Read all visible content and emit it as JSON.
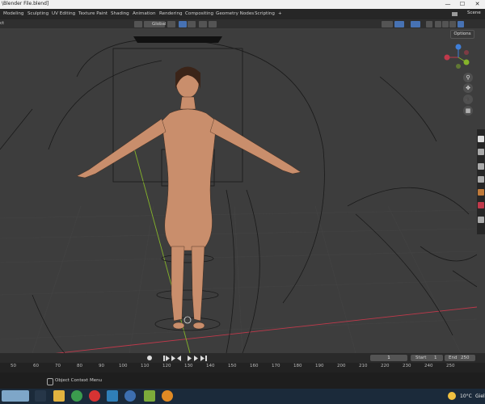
{
  "window": {
    "title": "\\Blender File.blend]",
    "minimize": "—",
    "maximize": "☐",
    "close": "✕"
  },
  "workspace_tabs": [
    {
      "label": "Modeling",
      "active": false
    },
    {
      "label": "Sculpting",
      "active": false
    },
    {
      "label": "UV Editing",
      "active": false
    },
    {
      "label": "Texture Paint",
      "active": false
    },
    {
      "label": "Shading",
      "active": false
    },
    {
      "label": "Animation",
      "active": false
    },
    {
      "label": "Rendering",
      "active": false
    },
    {
      "label": "Compositing",
      "active": false
    },
    {
      "label": "Geometry Nodes",
      "active": false
    },
    {
      "label": "Scripting",
      "active": false
    }
  ],
  "add_tab": "+",
  "scene": {
    "label": "Scene"
  },
  "header": {
    "mode_partial": "ct",
    "transform_orientation": "Global",
    "options": "Options"
  },
  "navigation": {
    "gizmo_axes": {
      "x": "X",
      "y": "Y",
      "z": "Z"
    },
    "zoom_icon": "⚲",
    "pan_icon": "✥",
    "camera_icon": "🎥",
    "grid_icon": "▦"
  },
  "timeline": {
    "current_frame": "1",
    "start_label": "Start",
    "start_value": "1",
    "end_label": "End",
    "end_value": "250",
    "ruler_ticks": [
      "50",
      "60",
      "70",
      "80",
      "90",
      "100",
      "110",
      "120",
      "130",
      "140",
      "150",
      "160",
      "170",
      "180",
      "190",
      "200",
      "210",
      "220",
      "230",
      "240",
      "250"
    ]
  },
  "status_bar": {
    "context_menu_hint": "Object Context Menu"
  },
  "taskbar": {
    "weather_temp": "10°C",
    "weather_text": "Giel"
  },
  "colors": {
    "viewport_bg": "#3d3d3d",
    "x_axis": "#c0394b",
    "y_axis": "#85b42a",
    "z_axis": "#3f7fd9",
    "active_tool": "#4772b3"
  }
}
